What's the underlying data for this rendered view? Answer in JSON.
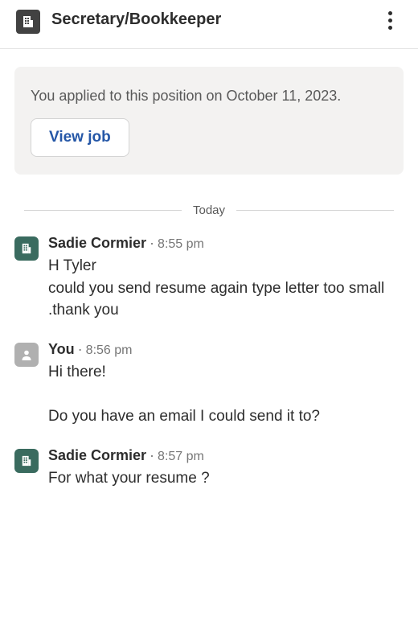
{
  "header": {
    "title": "Secretary/Bookkeeper"
  },
  "notice": {
    "text": "You applied to this position on October 11, 2023.",
    "button_label": "View job"
  },
  "date_separator": "Today",
  "messages": [
    {
      "avatar_type": "employer",
      "name": "Sadie Cormier",
      "time": "8:55 pm",
      "text": "H Tyler\ncould you send resume again type letter too small .thank you"
    },
    {
      "avatar_type": "user",
      "name": "You",
      "time": "8:56 pm",
      "text": "Hi there!\n\nDo you have an email I could send it to?"
    },
    {
      "avatar_type": "employer",
      "name": "Sadie Cormier",
      "time": "8:57 pm",
      "text": "For what your resume ?"
    }
  ]
}
